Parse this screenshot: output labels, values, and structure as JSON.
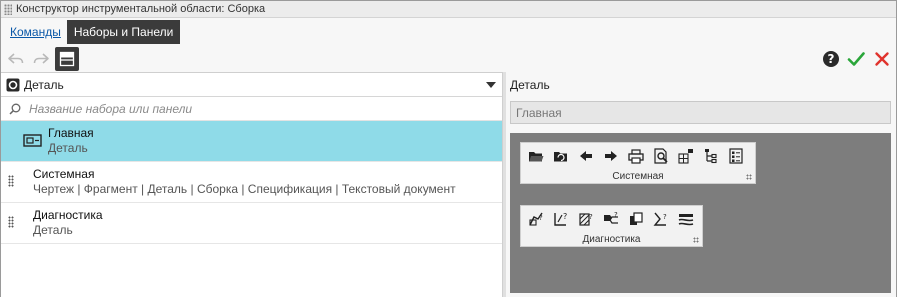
{
  "window": {
    "title": "Конструктор инструментальной области: Сборка"
  },
  "tabs": [
    {
      "label": "Команды",
      "active": false
    },
    {
      "label": "Наборы и Панели",
      "active": true
    }
  ],
  "toolbar": {
    "undo_icon": "undo-icon",
    "redo_icon": "redo-icon",
    "layout_icon": "panel-layout-icon",
    "help_icon": "help-icon",
    "ok_icon": "checkmark-icon",
    "cancel_icon": "close-icon",
    "ok_color": "#2aa63a",
    "cancel_color": "#e0332d"
  },
  "left": {
    "combo": {
      "value": "Деталь",
      "icon": "part-icon"
    },
    "search": {
      "placeholder": "Название набора или панели"
    },
    "items": [
      {
        "name": "Главная",
        "sub": "Деталь",
        "selected": true
      },
      {
        "name": "Системная",
        "sub": "Чертеж | Фрагмент | Деталь | Сборка | Спецификация | Текстовый документ",
        "selected": false
      },
      {
        "name": "Диагностика",
        "sub": "Деталь",
        "selected": false
      }
    ]
  },
  "right": {
    "label": "Деталь",
    "field_value": "Главная",
    "panels": [
      {
        "title": "Системная",
        "icons": [
          "open-folder-icon",
          "reload-icon",
          "arrow-left-icon",
          "arrow-right-icon",
          "print-icon",
          "preview-icon",
          "grid-icon",
          "tree-icon",
          "checklist-icon"
        ]
      },
      {
        "title": "Диагностика",
        "icons": [
          "diag1-icon",
          "diag2-icon",
          "diag3-icon",
          "diag4-icon",
          "diag5-icon",
          "diag6-icon",
          "diag7-icon"
        ]
      }
    ]
  },
  "colors": {
    "selection": "#8fdbe8",
    "preview_bg": "#7d7d7d",
    "dark_button": "#3b3b3b",
    "link": "#0a58a8"
  }
}
